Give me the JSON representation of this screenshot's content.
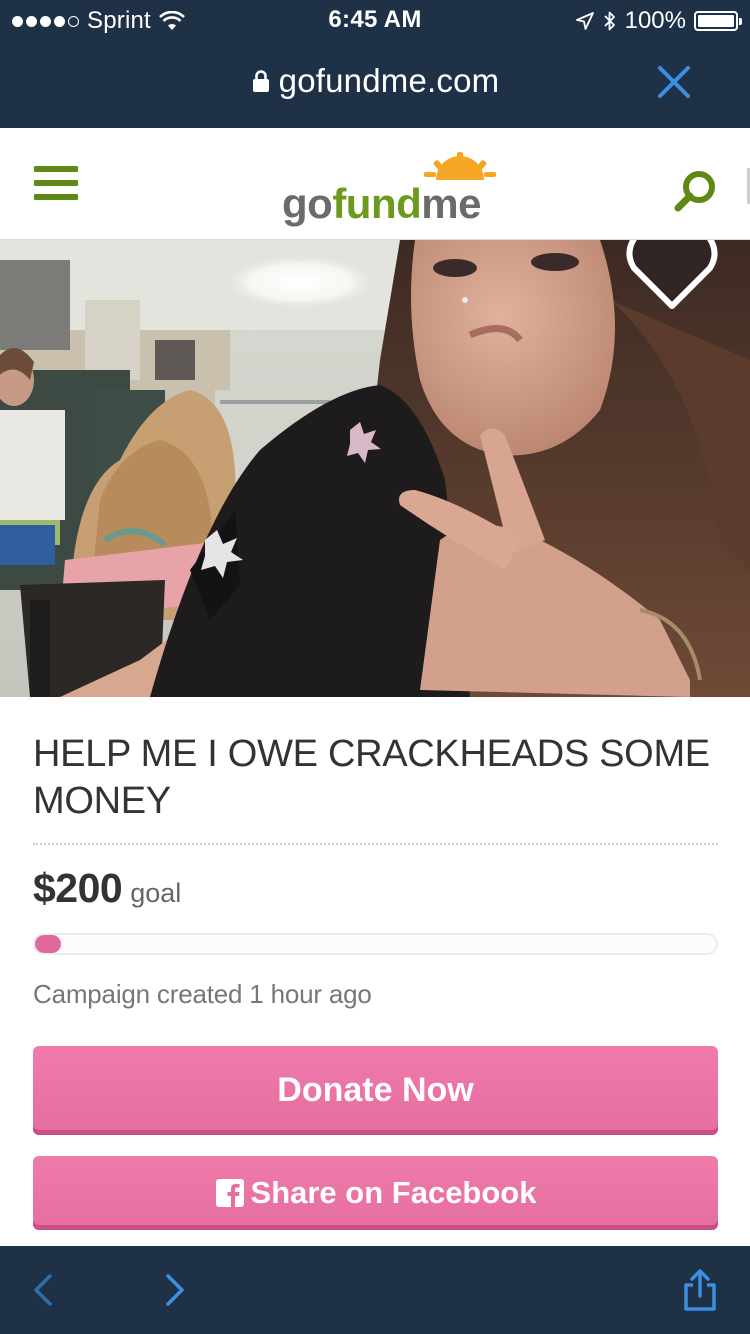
{
  "status_bar": {
    "carrier": "Sprint",
    "time": "6:45 AM",
    "battery": "100%",
    "signal_bars_filled": 4,
    "signal_bars_total": 5
  },
  "browser": {
    "url": "gofundme.com",
    "close_icon": "close-icon",
    "lock_icon": "lock-icon"
  },
  "site_header": {
    "menu_icon": "hamburger-menu-icon",
    "logo_text": {
      "part1": "go",
      "part2": "fund",
      "part3": "me"
    },
    "search_icon": "search-icon",
    "brand_color": "#6b9a1f"
  },
  "hero": {
    "favorite_icon": "heart-icon"
  },
  "campaign": {
    "title": "HELP ME I OWE CRACKHEADS SOME MONEY",
    "goal_amount": "$200",
    "goal_label": "goal",
    "progress_fraction": 0.035,
    "created_text": "Campaign created 1 hour ago",
    "donate_label": "Donate Now",
    "share_label": "Share on Facebook",
    "accent_color": "#e46e9f"
  },
  "toolbar": {
    "back_icon": "chevron-left-icon",
    "forward_icon": "chevron-right-icon",
    "share_icon": "share-icon"
  }
}
